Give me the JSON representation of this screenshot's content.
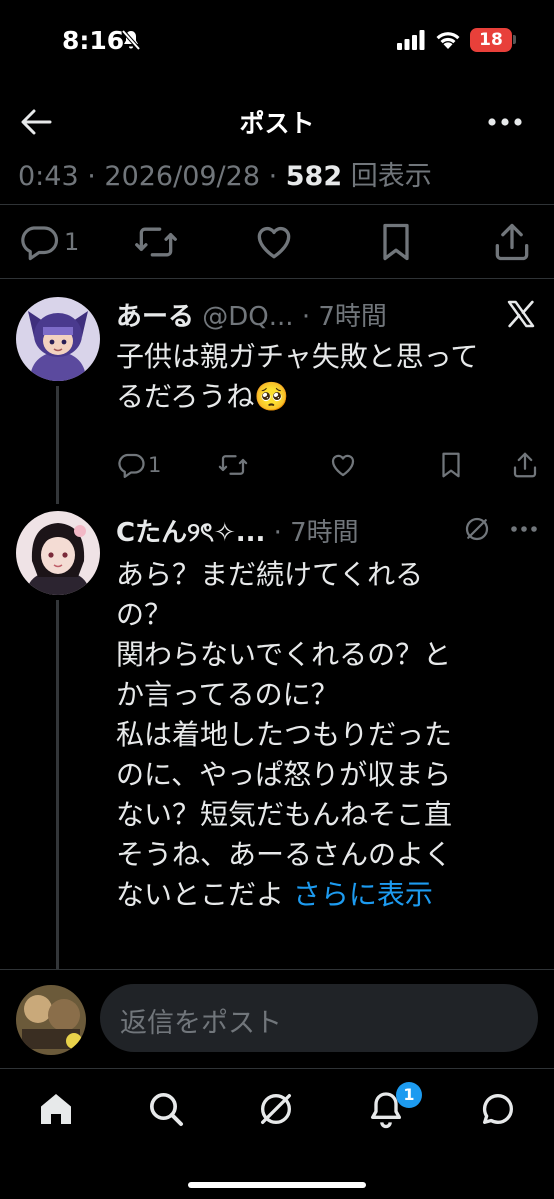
{
  "status_bar": {
    "time": "8:16",
    "battery": "18"
  },
  "header": {
    "title": "ポスト"
  },
  "meta": {
    "time": "0:43",
    "date": "2026/09/28",
    "views": "582",
    "views_label": "回表示",
    "separator": " · "
  },
  "main_actions": {
    "reply_count": "1"
  },
  "tweets": [
    {
      "name": "あーる",
      "handle": "@DQ...",
      "time": "7時間",
      "lines": [
        "子供は親ガチャ失敗と思って",
        "るだろうね🥺"
      ],
      "reply_count": "1"
    },
    {
      "name": "Cたん୨ৎ✧...",
      "time": "7時間",
      "lines": [
        "あら？まだ続けてくれる",
        "の？",
        "関わらないでくれるの？と",
        "か言ってるのに？",
        "私は着地したつもりだった",
        "のに、やっぱ怒りが収まら",
        "ない？短気だもんねそこ直",
        "そうね、あーるさんのよく",
        "ないとこだよ"
      ],
      "show_more": "さらに表示"
    }
  ],
  "reply": {
    "placeholder": "返信をポスト"
  },
  "tabbar": {
    "notifications_badge": "1"
  },
  "colors": {
    "accent": "#1d9bf0",
    "muted": "#71767b",
    "text": "#e7e9ea",
    "background": "#000000"
  },
  "icons": [
    "bell-slash-icon",
    "back-arrow-icon",
    "more-icon",
    "reply-icon",
    "retweet-icon",
    "like-icon",
    "bookmark-icon",
    "share-icon",
    "x-logo-icon",
    "grok-icon",
    "home-icon",
    "search-icon",
    "notifications-icon",
    "messages-icon"
  ]
}
